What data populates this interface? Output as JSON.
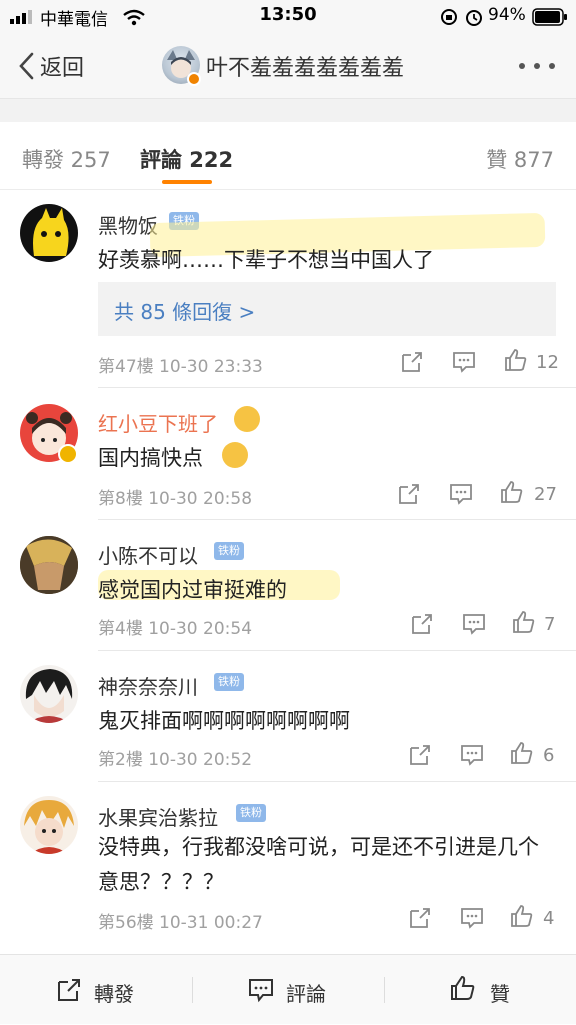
{
  "status_bar": {
    "carrier": "中華電信",
    "time": "13:50",
    "battery": "94%"
  },
  "nav": {
    "back_label": "返回",
    "title": "叶不羞羞羞羞羞羞羞",
    "more_icon": "more-dots-icon"
  },
  "tabs": {
    "reposts": "轉發 257",
    "comments": "評論 222",
    "likes": "贊 877",
    "active_color": "#ff8200"
  },
  "fan_badge_label": "铁粉",
  "comments": [
    {
      "name": "黑物饭",
      "text": "好羡慕啊……下辈子不想当中国人了",
      "replies": "共 85 條回復 >",
      "meta": "第47樓 10-30 23:33",
      "likes": "12"
    },
    {
      "name": "红小豆下班了",
      "text": "国内搞快点",
      "meta": "第8樓 10-30 20:58",
      "likes": "27"
    },
    {
      "name": "小陈不可以",
      "text": "感觉国内过审挺难的",
      "meta": "第4樓 10-30 20:54",
      "likes": "7"
    },
    {
      "name": "神奈奈奈川",
      "text": "鬼灭排面啊啊啊啊啊啊啊啊",
      "meta": "第2樓 10-30 20:52",
      "likes": "6"
    },
    {
      "name": "水果宾治紫拉",
      "text": "没特典，行我都没啥可说，可是还不引进是几个意思？？？？",
      "meta": "第56樓 10-31 00:27",
      "likes": "4"
    }
  ],
  "bottom_bar": {
    "repost": "轉發",
    "comment": "評論",
    "like": "贊"
  }
}
